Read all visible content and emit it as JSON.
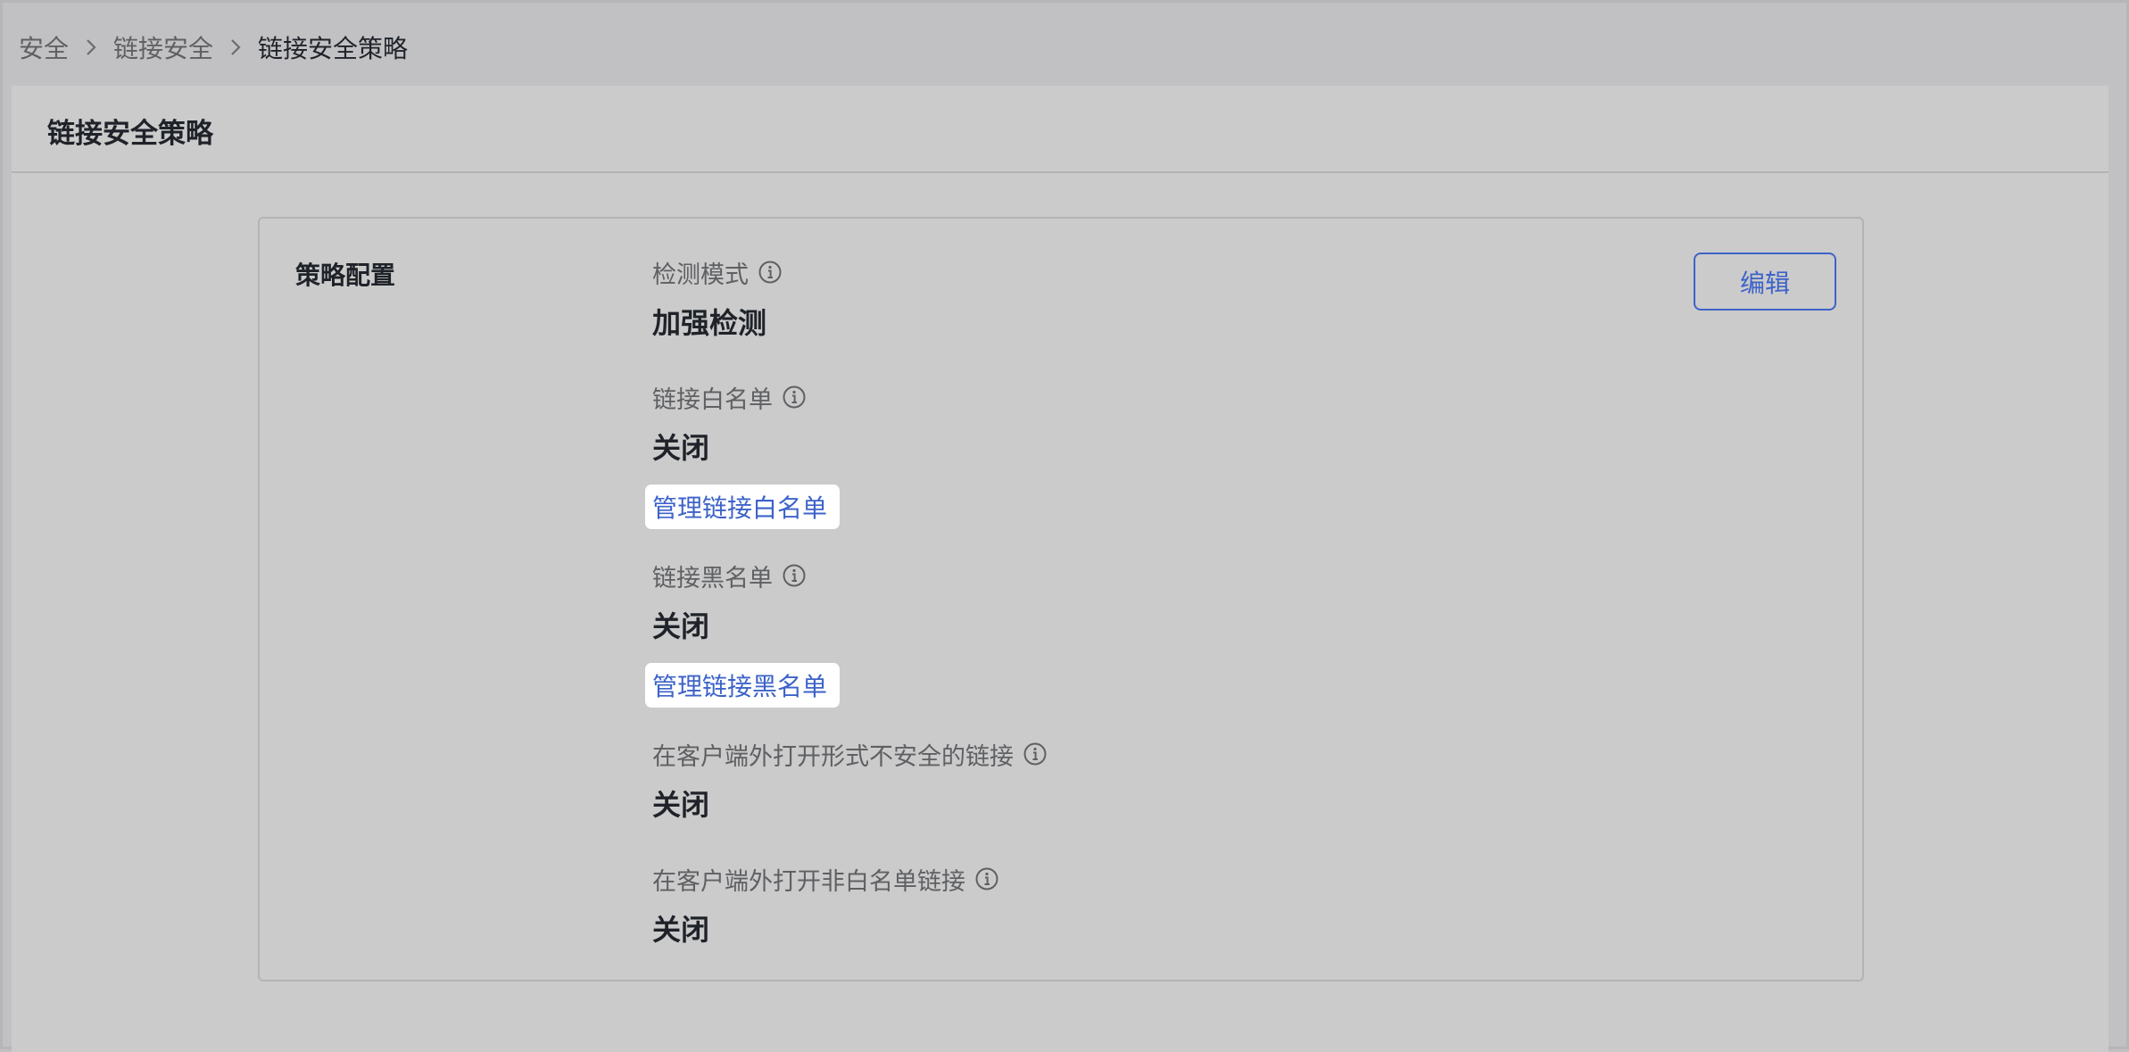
{
  "breadcrumb": {
    "items": [
      "安全",
      "链接安全",
      "链接安全策略"
    ]
  },
  "page": {
    "title": "链接安全策略"
  },
  "card": {
    "section_label": "策略配置",
    "edit_label": "编辑",
    "fields": [
      {
        "label": "检测模式",
        "value": "加强检测"
      },
      {
        "label": "链接白名单",
        "value": "关闭",
        "link": "管理链接白名单"
      },
      {
        "label": "链接黑名单",
        "value": "关闭",
        "link": "管理链接黑名单"
      },
      {
        "label": "在客户端外打开形式不安全的链接",
        "value": "关闭"
      },
      {
        "label": "在客户端外打开非白名单链接",
        "value": "关闭"
      }
    ]
  },
  "colors": {
    "accent": "#3d63c9",
    "background": "#c1c1c3",
    "panel": "#cbcbcb"
  },
  "icons": {
    "breadcrumb_separator": "chevron-right-icon",
    "field_help": "info-icon"
  }
}
